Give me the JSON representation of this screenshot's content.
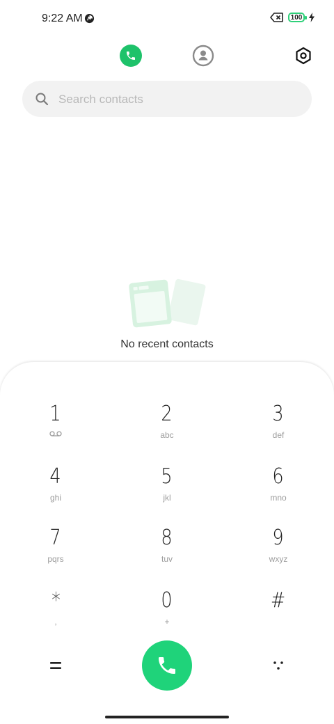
{
  "status_bar": {
    "time": "9:22 AM",
    "battery_level": "100"
  },
  "tabs": [
    {
      "name": "recents",
      "icon": "phone-icon",
      "active": true
    },
    {
      "name": "contacts",
      "icon": "person-icon",
      "active": false
    }
  ],
  "search": {
    "placeholder": "Search contacts"
  },
  "recents": {
    "empty_text": "No recent contacts"
  },
  "dialpad": {
    "keys": [
      {
        "digit": "1",
        "letters": ""
      },
      {
        "digit": "2",
        "letters": "abc"
      },
      {
        "digit": "3",
        "letters": "def"
      },
      {
        "digit": "4",
        "letters": "ghi"
      },
      {
        "digit": "5",
        "letters": "jkl"
      },
      {
        "digit": "6",
        "letters": "mno"
      },
      {
        "digit": "7",
        "letters": "pqrs"
      },
      {
        "digit": "8",
        "letters": "tuv"
      },
      {
        "digit": "9",
        "letters": "wxyz"
      },
      {
        "digit": "*",
        "letters": ","
      },
      {
        "digit": "0",
        "letters": "+"
      },
      {
        "digit": "#",
        "letters": ""
      }
    ]
  },
  "colors": {
    "accent": "#1ec26a",
    "call_button": "#1fd37a",
    "battery_outline": "#2fd07a",
    "search_bg": "#f2f2f2"
  }
}
